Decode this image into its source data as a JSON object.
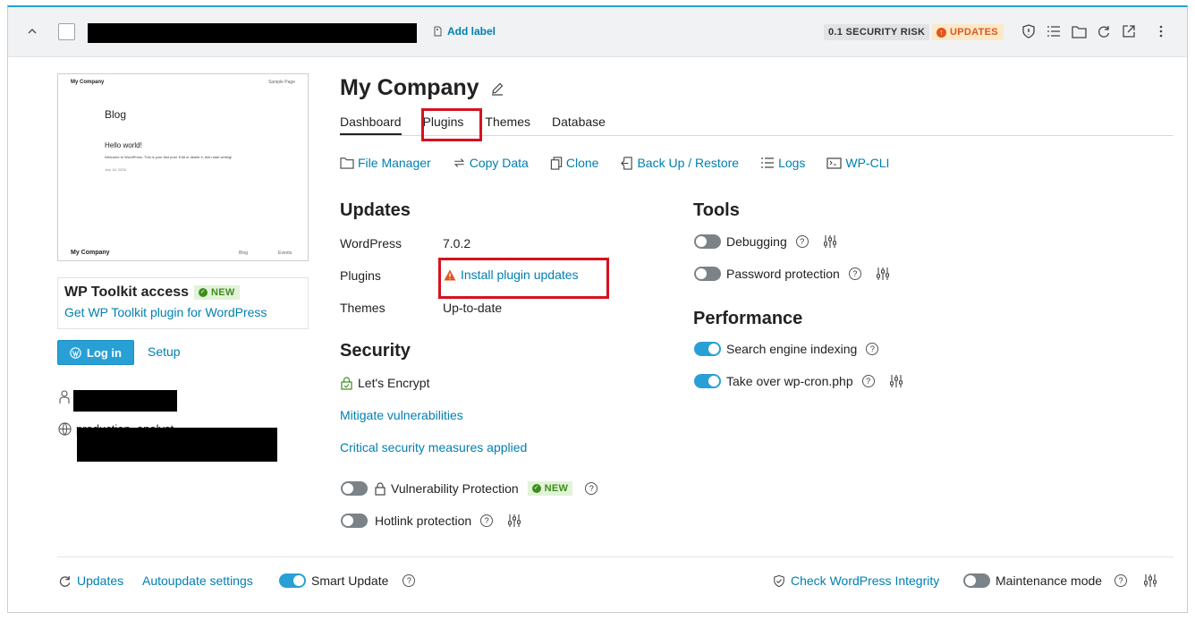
{
  "header": {
    "add_label": "Add label",
    "security_risk": "0.1 SECURITY RISK",
    "updates_badge": "UPDATES"
  },
  "thumbnail": {
    "site": "My Company",
    "nav": "Sample Page",
    "heading": "Blog",
    "post_title": "Hello world!",
    "post_excerpt": "Welcome to WordPress. This is your first post. Edit or delete it, then start writing!",
    "post_date": "July 18, 2026",
    "footer_site": "My Company",
    "footer_blog": "Blog",
    "footer_events": "Events"
  },
  "wp_toolkit": {
    "title": "WP Toolkit access",
    "new_badge": "NEW",
    "get_link": "Get WP Toolkit plugin for WordPress"
  },
  "login_button": "Log in",
  "setup_link": "Setup",
  "owner_partial": "production_analyst",
  "site": {
    "title": "My Company"
  },
  "tabs": [
    "Dashboard",
    "Plugins",
    "Themes",
    "Database"
  ],
  "actions": [
    "File Manager",
    "Copy Data",
    "Clone",
    "Back Up / Restore",
    "Logs",
    "WP-CLI"
  ],
  "updates": {
    "title": "Updates",
    "rows": [
      {
        "label": "WordPress",
        "value": "7.0.2"
      },
      {
        "label": "Plugins",
        "value": "Install plugin updates"
      },
      {
        "label": "Themes",
        "value": "Up-to-date"
      }
    ]
  },
  "security": {
    "title": "Security",
    "ssl": "Let's Encrypt",
    "mitigate": "Mitigate vulnerabilities",
    "critical": "Critical security measures applied",
    "vuln_protection": "Vulnerability Protection",
    "vuln_badge": "NEW",
    "hotlink": "Hotlink protection"
  },
  "tools": {
    "title": "Tools",
    "debugging": "Debugging",
    "password": "Password protection"
  },
  "performance": {
    "title": "Performance",
    "search_indexing": "Search engine indexing",
    "wp_cron": "Take over wp-cron.php"
  },
  "footer": {
    "updates": "Updates",
    "autoupdate": "Autoupdate settings",
    "smart_update": "Smart Update",
    "integrity": "Check WordPress Integrity",
    "maintenance": "Maintenance mode"
  },
  "colors": {
    "accent": "#28a0d6",
    "link": "#007fb1",
    "warning": "#e0561b",
    "highlight": "#d6111f"
  }
}
